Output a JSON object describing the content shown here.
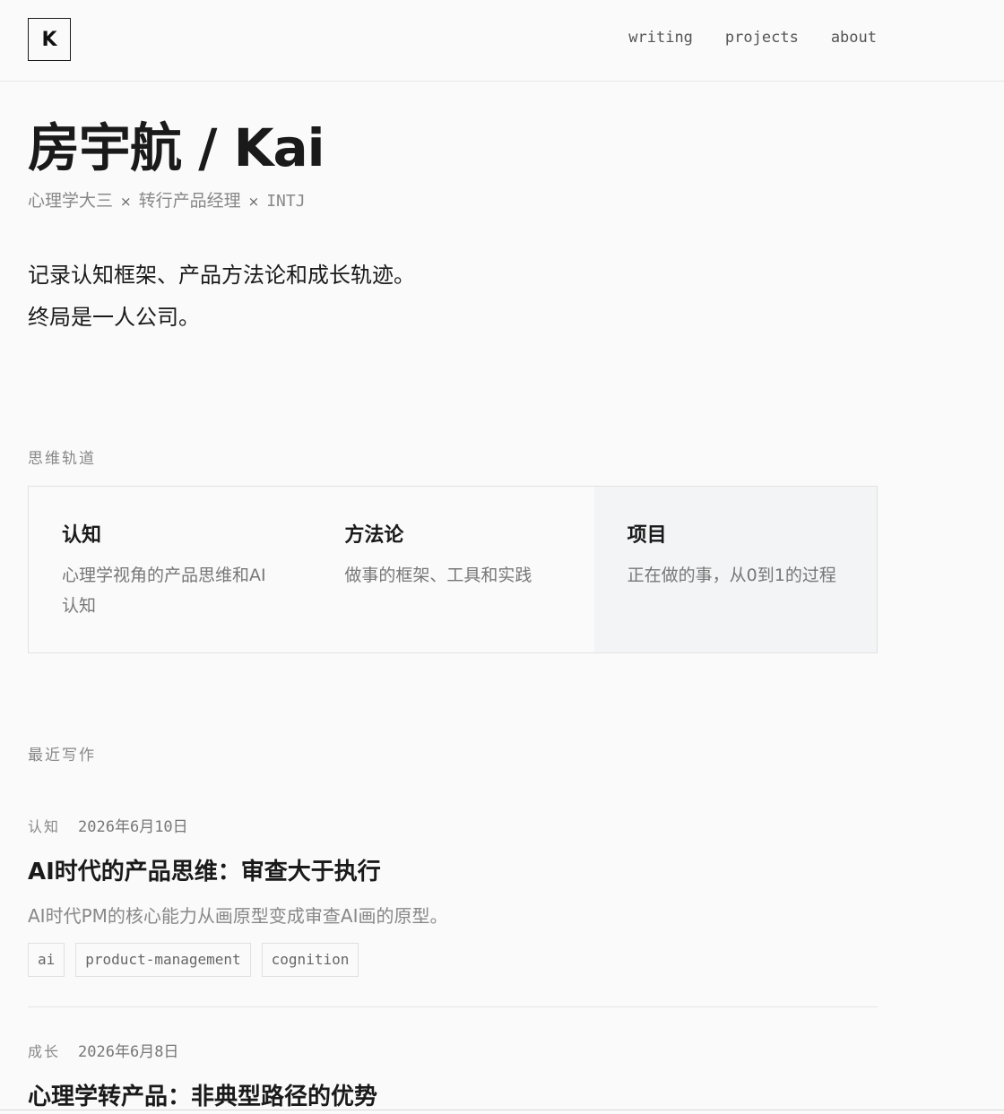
{
  "header": {
    "logo": "K",
    "nav": [
      "writing",
      "projects",
      "about"
    ]
  },
  "hero": {
    "title": "房宇航 / Kai",
    "subtitle": {
      "part1": "心理学大三",
      "sep": "×",
      "part2": "转行产品经理",
      "part3": "INTJ"
    },
    "intro_lines": [
      "记录认知框架、产品方法论和成长轨迹。",
      "终局是一人公司。"
    ]
  },
  "tracks_section": {
    "label": "思维轨道",
    "items": [
      {
        "title": "认知",
        "desc": "心理学视角的产品思维和AI认知",
        "active": false
      },
      {
        "title": "方法论",
        "desc": "做事的框架、工具和实践",
        "active": false
      },
      {
        "title": "项目",
        "desc": "正在做的事，从0到1的过程",
        "active": true
      }
    ]
  },
  "recent_section": {
    "label": "最近写作",
    "posts": [
      {
        "category": "认知",
        "date": "2026年6月10日",
        "title": "AI时代的产品思维：审查大于执行",
        "excerpt": "AI时代PM的核心能力从画原型变成审查AI画的原型。",
        "tags": [
          "ai",
          "product-management",
          "cognition"
        ]
      },
      {
        "category": "成长",
        "date": "2026年6月8日",
        "title": "心理学转产品：非典型路径的优势"
      }
    ]
  }
}
